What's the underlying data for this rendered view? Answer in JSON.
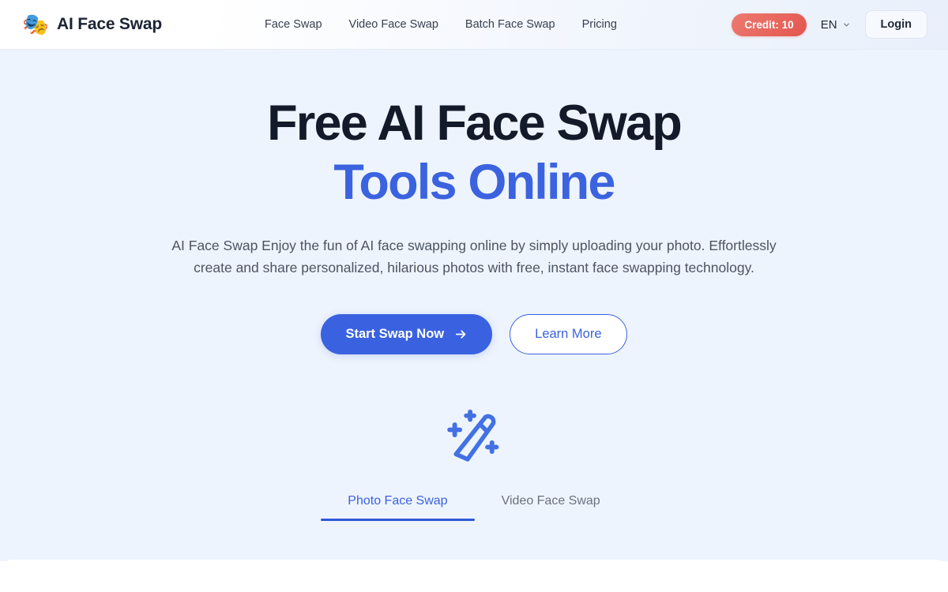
{
  "header": {
    "brand": {
      "logo_icon": "theatre-masks-icon",
      "logo_glyph": "🎭",
      "name": "AI Face Swap"
    },
    "nav": [
      {
        "label": "Face Swap"
      },
      {
        "label": "Video Face Swap"
      },
      {
        "label": "Batch Face Swap"
      },
      {
        "label": "Pricing"
      }
    ],
    "credit": {
      "label": "Credit: 10",
      "color": "#e2564f"
    },
    "language": {
      "value": "EN",
      "icon": "chevron-down-icon"
    },
    "login": {
      "label": "Login"
    }
  },
  "hero": {
    "title_line1": "Free AI Face Swap",
    "title_line2": "Tools Online",
    "title_color": "#131a2a",
    "accent_color": "#3b63df",
    "description": "AI Face Swap Enjoy the fun of AI face swapping online by simply uploading your photo. Effortlessly create and share personalized, hilarious photos with free, instant face swapping technology.",
    "primary_cta": {
      "label": "Start Swap Now",
      "icon": "arrow-right-icon"
    },
    "secondary_cta": {
      "label": "Learn More"
    },
    "feature_icon": "magic-wand-icon",
    "tabs": [
      {
        "label": "Photo Face Swap",
        "active": true
      },
      {
        "label": "Video Face Swap",
        "active": false
      }
    ]
  }
}
